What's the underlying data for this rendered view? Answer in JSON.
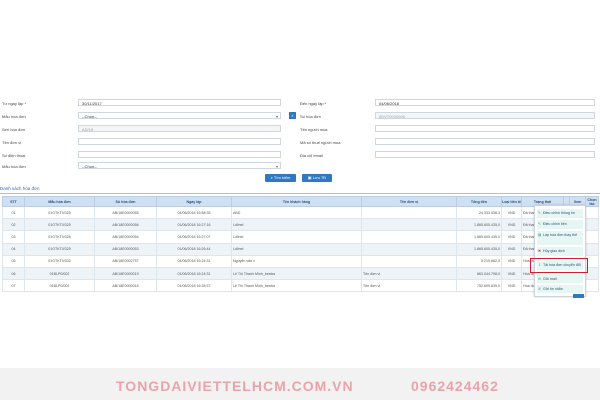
{
  "form": {
    "from_date_label": "Từ ngày lập *",
    "from_date_value": "30/11/2017",
    "to_date_label": "Đến ngày lập *",
    "to_date_value": "04/06/2018",
    "template_label": "Mẫu hóa đơn",
    "template_value": "--Chọn--",
    "invoice_no_label": "Số hóa đơn",
    "invoice_no_value": "8DVT0000006",
    "serial_label": "Seri hóa đơn",
    "serial_value": "AD/18",
    "buyer_name_label": "Tên người mua",
    "buyer_name_value": "",
    "unit_label": "Tên đơn vị",
    "unit_value": "",
    "tax_code_label": "Mã số thuế người mua",
    "tax_code_value": "",
    "phone_label": "Số điện thoại",
    "phone_value": "",
    "email_label": "Địa chỉ email",
    "email_value": "",
    "invoice_type_label": "Mẫu hóa đơn",
    "invoice_type_value": "--Chọn--",
    "search_button": "Tìm kiếm",
    "save_button": "Lưu TĐ"
  },
  "section_title": "Danh sách hóa đơn",
  "table": {
    "headers": [
      "STT",
      "Mẫu hóa đơn",
      "Số hóa đơn",
      "Ngày lập",
      "Tên khách hàng",
      "Tên đơn vị",
      "Tổng tiền",
      "Loại tiền tệ",
      "Trạng thái",
      "",
      "Xem",
      "Chọn tác"
    ],
    "rows": [
      [
        "01",
        "01GTKT0/325",
        "AB/18E0000055",
        "01/06/2018 16:58:35",
        "ABD",
        "",
        "24.333.538,3",
        "VND",
        "Đã thanh toán",
        "",
        "",
        ""
      ],
      [
        "02",
        "01GTKT0/325",
        "AB/18E0000056",
        "01/06/2018 16:27:16",
        "Ldlinel",
        "",
        "1.865.605.435,0",
        "VND",
        "Đã thanh toán",
        "",
        "",
        ""
      ],
      [
        "03",
        "01GTKT0/326",
        "AB/18E0000054",
        "01/06/2018 16:27:07",
        "Ldlinel",
        "",
        "1.865.605.435,0",
        "VND",
        "Đã thanh toán",
        "",
        "",
        ""
      ],
      [
        "04",
        "01GTKT0/325",
        "AB/18E0000053",
        "01/06/2018 16:26:44",
        "Ldlinel",
        "",
        "1.865.605.435,0",
        "VND",
        "Đã thanh toán",
        "",
        "",
        ""
      ],
      [
        "05",
        "01GTKT0/332",
        "AB/18E0002757",
        "01/06/2018 16:24:31",
        "Nguyễn văn x",
        "",
        "5.215.682,5",
        "VND",
        "Hóa đơn thay thế",
        "",
        "",
        ""
      ],
      [
        "06",
        "01BLP0/002",
        "AB/18E0000019",
        "01/06/2018 16:24:31",
        "Lê Thị Thanh Minh_bestcs",
        "Tên đơn vị",
        "863.044.798,0",
        "VND",
        "Hóa đơn thay thế",
        "",
        "",
        ""
      ],
      [
        "07",
        "01BLP0/002",
        "AB/18E0000016",
        "01/06/2018 16:28:37",
        "Lê Thị Thanh Minh_bestcs",
        "Tên đơn vị",
        "752.609.839,0",
        "VND",
        "Hóa đơn thay thế",
        "",
        "",
        ""
      ]
    ]
  },
  "context_menu": {
    "items": [
      "Điều chỉnh thông tin",
      "Điều chỉnh tiền",
      "Lập hóa đơn thay thế",
      "Hủy giao dịch",
      "Tải hóa đơn chuyển đổi",
      "Gửi mail",
      "Gửi tin nhắn"
    ]
  },
  "footer": {
    "brand": "TONGDAIVIETTELHCM.COM.VN",
    "phone": "0962424462"
  }
}
